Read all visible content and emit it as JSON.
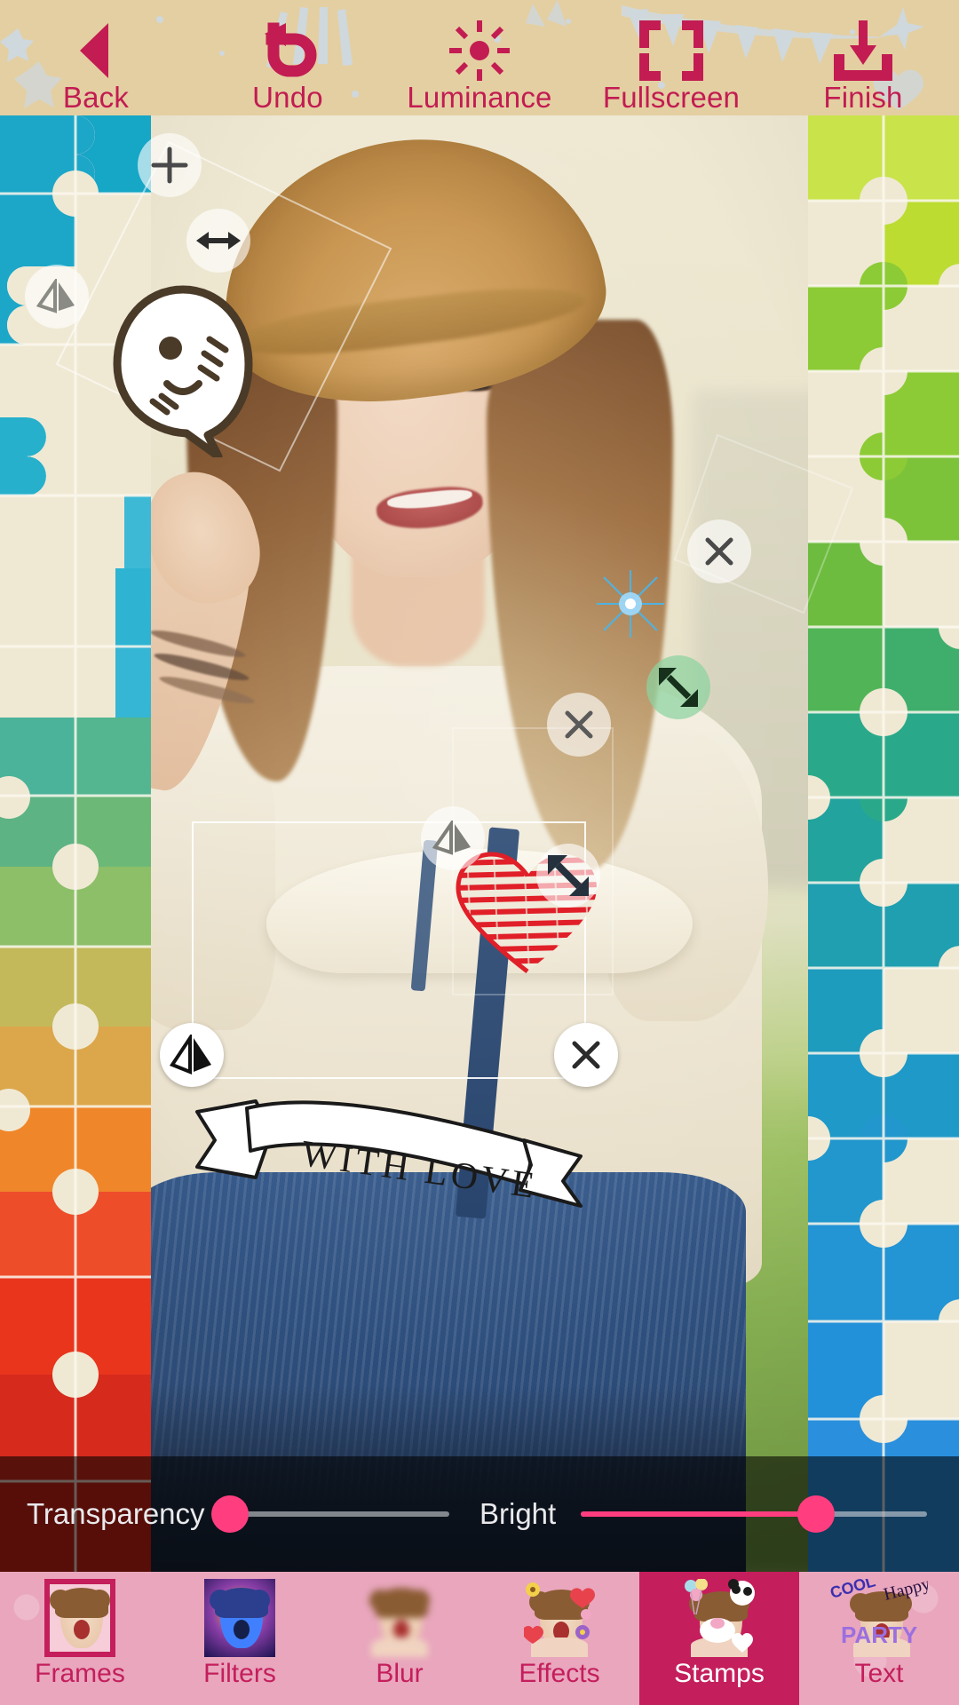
{
  "app": {
    "screen_name": "photo-editor-stamps"
  },
  "topbar": {
    "background_color": "#e4cfa2",
    "accent_color": "#c21c52",
    "items": [
      {
        "label": "Back",
        "icon": "back-triangle-icon"
      },
      {
        "label": "Undo",
        "icon": "undo-arrow-icon"
      },
      {
        "label": "Luminance",
        "icon": "sun-brightness-icon"
      },
      {
        "label": "Fullscreen",
        "icon": "fullscreen-brackets-icon"
      },
      {
        "label": "Finish",
        "icon": "download-save-icon"
      }
    ]
  },
  "canvas": {
    "frame_style": "puzzle-frame",
    "stickers": [
      {
        "name": "ghost-emoji-sticker",
        "selected": false,
        "handles": [
          "rotate-plus-handle",
          "flip-handle",
          "resize-handle"
        ]
      },
      {
        "name": "heart-doodle-sticker",
        "selected": false,
        "handles": [
          "flip-handle",
          "close-handle",
          "resize-handle"
        ]
      },
      {
        "name": "with-love-ribbon-sticker",
        "selected": true,
        "handles": [
          "flip-handle",
          "close-handle"
        ],
        "text": "WITH LOVE"
      },
      {
        "name": "sparkle-light-sticker",
        "selected": false,
        "handles": [
          "rotate-plus-handle",
          "resize-handle"
        ]
      }
    ]
  },
  "sliders": {
    "transparency": {
      "label": "Transparency",
      "value_percent": 0,
      "thumb_color": "#ff3d7f",
      "track_color": "#e6e6eb"
    },
    "bright": {
      "label": "Bright",
      "value_percent": 68,
      "thumb_color": "#ff3d7f",
      "fill_color": "#ff3d7f",
      "track_color": "#e6e6eb"
    }
  },
  "bottomnav": {
    "background_color": "#e9a6bd",
    "active_color": "#c41e5c",
    "active_index": 4,
    "items": [
      {
        "label": "Frames",
        "icon": "frames-thumb-icon"
      },
      {
        "label": "Filters",
        "icon": "filters-thumb-icon"
      },
      {
        "label": "Blur",
        "icon": "blur-thumb-icon"
      },
      {
        "label": "Effects",
        "icon": "effects-thumb-icon"
      },
      {
        "label": "Stamps",
        "icon": "stamps-thumb-icon"
      },
      {
        "label": "Text",
        "icon": "text-thumb-icon"
      }
    ],
    "text_thumb_words": {
      "word1": "Happy",
      "word2": "PARTY",
      "word3": "COOL"
    }
  }
}
